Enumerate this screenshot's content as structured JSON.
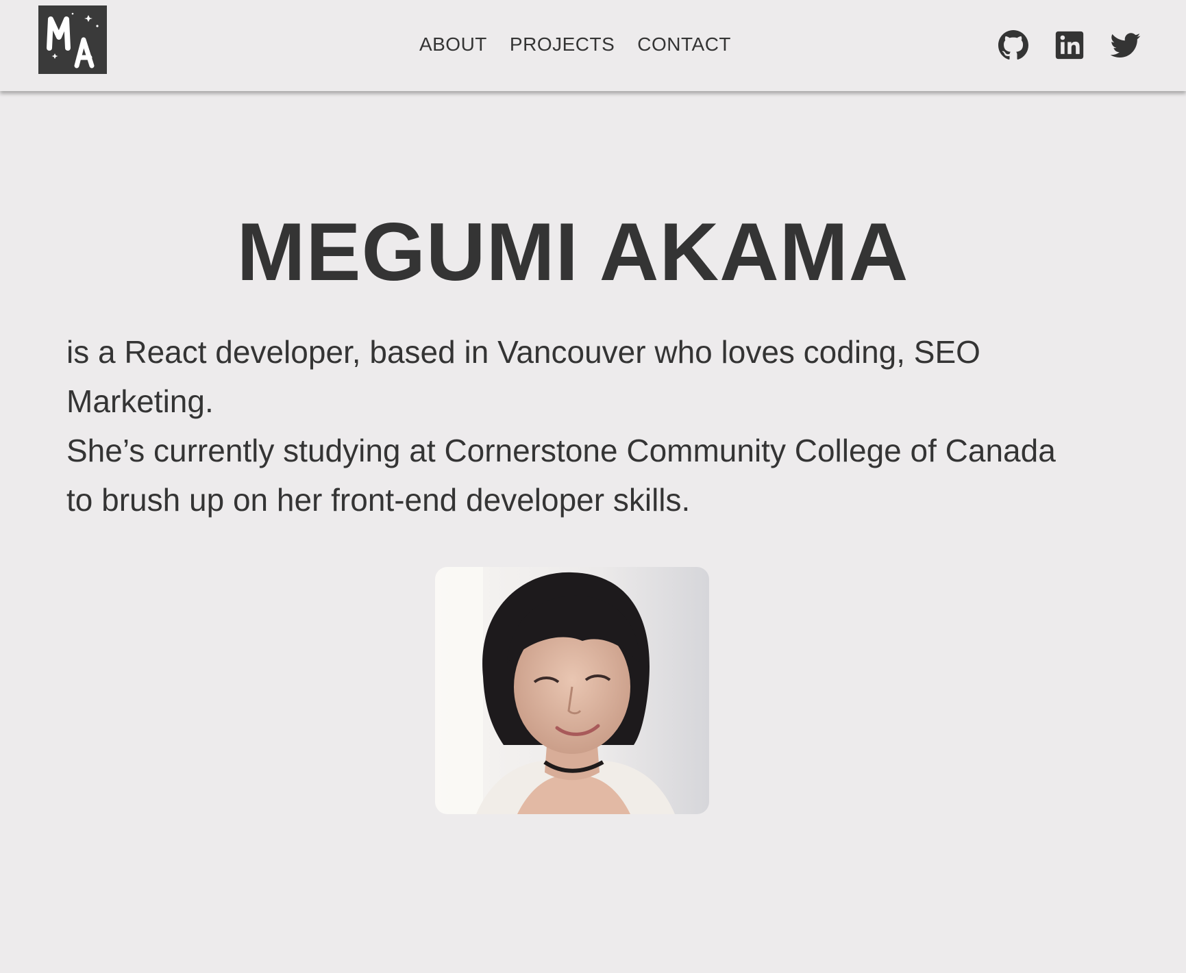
{
  "header": {
    "logo": {
      "letters": "MA",
      "icon": "ma-monogram-logo"
    },
    "nav": [
      {
        "label": "ABOUT"
      },
      {
        "label": "PROJECTS"
      },
      {
        "label": "CONTACT"
      }
    ],
    "social": [
      {
        "icon": "github-icon"
      },
      {
        "icon": "linkedin-icon"
      },
      {
        "icon": "twitter-icon"
      }
    ]
  },
  "hero": {
    "name": "MEGUMI AKAMA",
    "bio_line1": "is a React developer, based in Vancouver who loves coding, SEO Marketing.",
    "bio_line2": "She’s currently studying at Cornerstone Community College of Canada to brush up on her front-end developer skills."
  },
  "colors": {
    "background": "#edebec",
    "text": "#343434",
    "logo_bg": "#3a3a3a"
  }
}
